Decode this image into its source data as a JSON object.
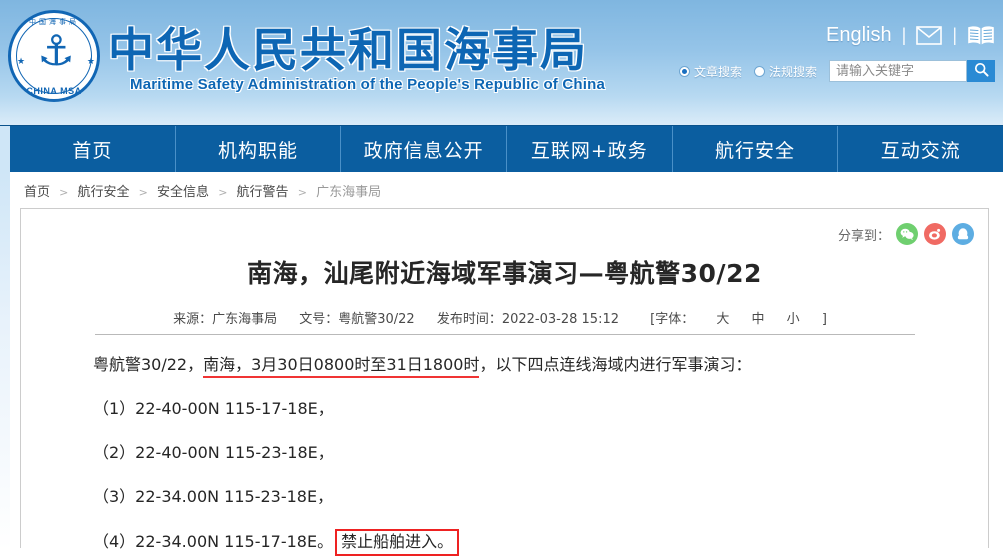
{
  "header": {
    "logo": {
      "top_text": "中国海事局",
      "bottom_text": "CHINA MSA",
      "icon": "anchor-icon"
    },
    "site_title": "中华人民共和国海事局",
    "site_subtitle": "Maritime Safety Administration of the People's Republic of China",
    "english_link": "English",
    "separator": "|",
    "mail_icon": "envelope-icon",
    "book_icon": "book-icon",
    "search": {
      "option_article": "文章搜索",
      "option_regulation": "法规搜索",
      "selected_option": "文章搜索",
      "placeholder": "请输入关键字",
      "value": "",
      "button_icon": "search-icon"
    }
  },
  "nav": {
    "items": [
      {
        "label": "首页"
      },
      {
        "label": "机构职能"
      },
      {
        "label": "政府信息公开"
      },
      {
        "label": "互联网+政务"
      },
      {
        "label": "航行安全"
      },
      {
        "label": "互动交流"
      }
    ]
  },
  "breadcrumb": {
    "separator": ">",
    "items": [
      {
        "label": "首页"
      },
      {
        "label": "航行安全"
      },
      {
        "label": "安全信息"
      },
      {
        "label": "航行警告"
      },
      {
        "label": "广东海事局"
      }
    ]
  },
  "article": {
    "share_label": "分享到：",
    "share_targets": [
      {
        "name": "wechat",
        "color": "#6fcf6f"
      },
      {
        "name": "weibo",
        "color": "#f06a63"
      },
      {
        "name": "qq",
        "color": "#5dade2"
      }
    ],
    "title": "南海，汕尾附近海域军事演习—粤航警30/22",
    "meta": {
      "source": "来源：广东海事局",
      "doc_number": "文号：粤航警30/22",
      "publish_time": "发布时间：2022-03-28 15:12",
      "font_prefix": "[字体：",
      "font_large": "大",
      "font_medium": "中",
      "font_small": "小",
      "font_suffix": "]"
    },
    "body": {
      "p1_prefix": "粤航警30/22，",
      "p1_highlight": "南海，3月30日0800时至31日1800时",
      "p1_suffix": "，以下四点连线海域内进行军事演习：",
      "p2": "（1）22-40-00N 115-17-18E，",
      "p3": "（2）22-40-00N 115-23-18E，",
      "p4": "（3）22-34.00N 115-23-18E，",
      "p5_prefix": "（4）22-34.00N 115-17-18E。",
      "p5_boxed": "禁止船舶进入。"
    }
  },
  "colors": {
    "nav_blue": "#0b5ea0",
    "title_blue": "#0d66b4",
    "highlight_red": "#f03434",
    "box_red": "#ee2222"
  }
}
